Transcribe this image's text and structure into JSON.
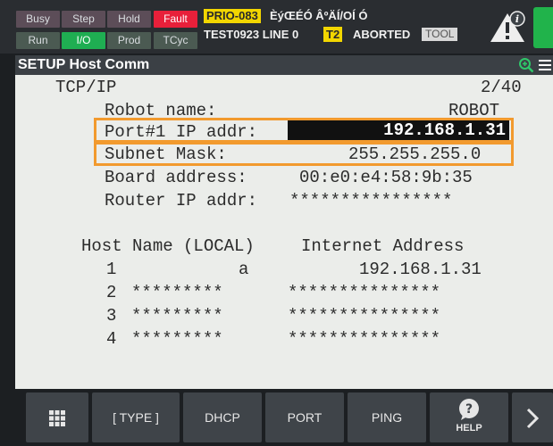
{
  "status_leds": {
    "busy": "Busy",
    "step": "Step",
    "hold": "Hold",
    "fault": "Fault",
    "run": "Run",
    "io": "I/O",
    "prod": "Prod",
    "tcyc": "TCyc"
  },
  "status": {
    "prio_badge": "PRIO-083",
    "prio_message": "ÈýŒÉÓ ÂºÄÍ/OÍ   Ó",
    "program_line": "TEST0923 LINE 0",
    "mode_badge": "T2",
    "state": "ABORTED",
    "tool_badge": "TOOL"
  },
  "screen": {
    "title": "SETUP Host Comm",
    "header": "TCP/IP",
    "page": "2/40",
    "robot_name_label": "Robot name:",
    "robot_name_value": "ROBOT",
    "port_ip_label": "Port#1 IP addr:",
    "port_ip_value": "192.168.1.31",
    "subnet_label": "Subnet Mask:",
    "subnet_value": "255.255.255.0",
    "board_label": "Board address:",
    "board_value": "00:e0:e4:58:9b:35",
    "router_label": "Router IP addr:",
    "router_value": "****************",
    "host_table": {
      "col_host": "Host Name (LOCAL)",
      "col_address": "Internet Address",
      "rows": [
        {
          "num": "1",
          "name": "a",
          "address": "192.168.1.31"
        },
        {
          "num": "2",
          "name": "*********",
          "address": "***************"
        },
        {
          "num": "3",
          "name": "*********",
          "address": "***************"
        },
        {
          "num": "4",
          "name": "*********",
          "address": "***************"
        }
      ]
    }
  },
  "function_keys": {
    "type": "[ TYPE ]",
    "dhcp": "DHCP",
    "port": "PORT",
    "ping": "PING",
    "help": "HELP"
  },
  "icons": [
    "menu-grid-icon",
    "help-icon",
    "next-arrow-icon",
    "warning-icon",
    "zoom-icon",
    "hamburger-menu-icon"
  ],
  "colors": {
    "fault": "#e8203a",
    "io_active": "#1fae52",
    "highlight": "#f29a2e",
    "badge_yellow": "#f2d600"
  }
}
